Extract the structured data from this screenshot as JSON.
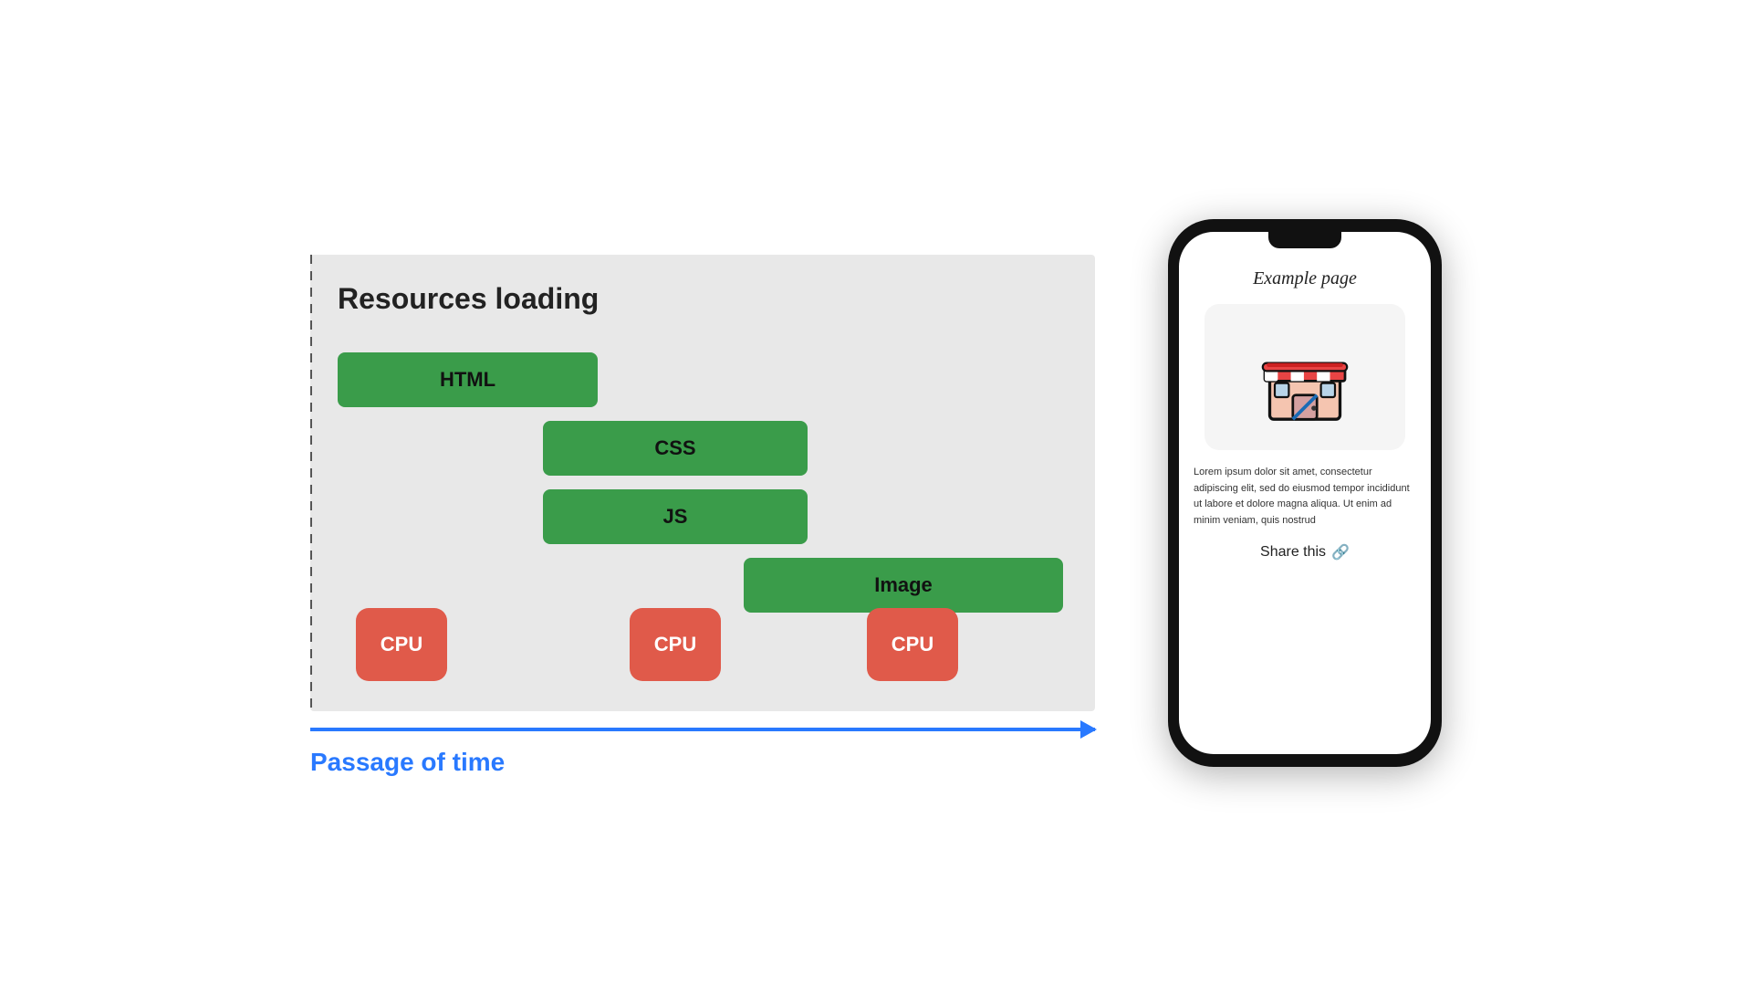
{
  "diagram": {
    "title": "Resources loading",
    "bars": [
      {
        "id": "html",
        "label": "HTML"
      },
      {
        "id": "css",
        "label": "CSS"
      },
      {
        "id": "js",
        "label": "JS"
      },
      {
        "id": "image",
        "label": "Image"
      }
    ],
    "cpu_labels": [
      "CPU",
      "CPU",
      "CPU"
    ],
    "time_label": "Passage of time"
  },
  "phone": {
    "title": "Example page",
    "body_text": "Lorem ipsum dolor sit amet, consectetur adipiscing elit, sed do eiusmod tempor incididunt ut labore et dolore magna aliqua. Ut enim ad minim veniam, quis nostrud",
    "share_label": "Share this",
    "store_icon_name": "store-icon"
  }
}
